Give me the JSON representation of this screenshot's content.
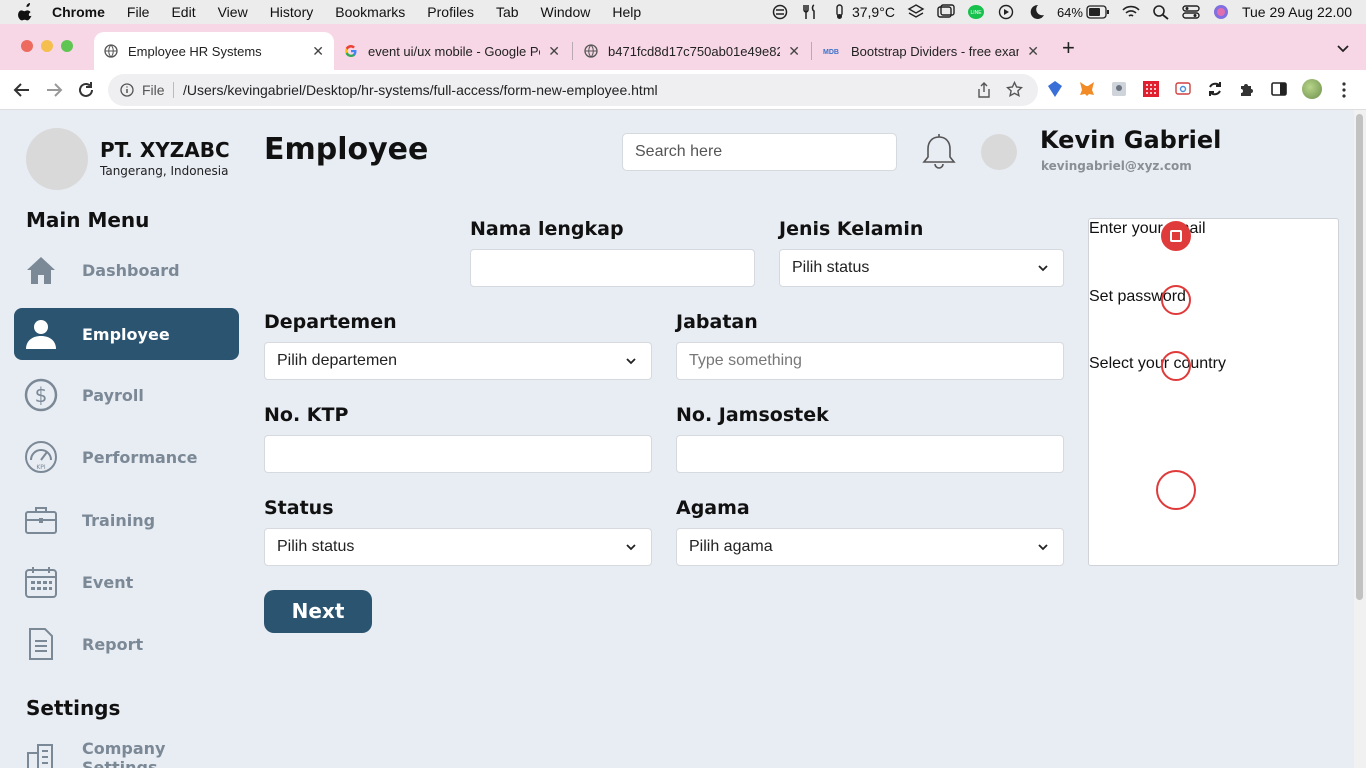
{
  "macos": {
    "app_name": "Chrome",
    "menus": [
      "File",
      "Edit",
      "View",
      "History",
      "Bookmarks",
      "Profiles",
      "Tab",
      "Window",
      "Help"
    ],
    "temperature": "37,9°C",
    "battery": "64%",
    "datetime": "Tue 29 Aug  22.00"
  },
  "browser": {
    "tabs": [
      {
        "label": "Employee HR Systems",
        "icon": "globe-icon"
      },
      {
        "label": "event ui/ux mobile - Google Pe",
        "icon": "google-icon"
      },
      {
        "label": "b471fcd8d17c750ab01e49e82",
        "icon": "globe-icon"
      },
      {
        "label": "Bootstrap Dividers - free exam",
        "icon": "mdb-icon"
      }
    ],
    "scheme_label": "File",
    "url": "/Users/kevingabriel/Desktop/hr-systems/full-access/form-new-employee.html"
  },
  "sidebar": {
    "company_name": "PT. XYZABC",
    "company_location": "Tangerang, Indonesia",
    "main_menu_title": "Main Menu",
    "items": [
      {
        "label": "Dashboard",
        "icon": "home-icon"
      },
      {
        "label": "Employee",
        "icon": "user-icon"
      },
      {
        "label": "Payroll",
        "icon": "dollar-icon"
      },
      {
        "label": "Performance",
        "icon": "gauge-icon"
      },
      {
        "label": "Training",
        "icon": "briefcase-icon"
      },
      {
        "label": "Event",
        "icon": "calendar-icon"
      },
      {
        "label": "Report",
        "icon": "document-icon"
      }
    ],
    "settings_title": "Settings",
    "settings_items": [
      {
        "label": "Company Settings",
        "icon": "building-icon"
      }
    ]
  },
  "header": {
    "page_title": "Employee",
    "search_placeholder": "Search here",
    "user_name": "Kevin Gabriel",
    "user_email": "kevingabriel@xyz.com"
  },
  "form": {
    "nama_label": "Nama lengkap",
    "nama_value": "",
    "gender_label": "Jenis Kelamin",
    "gender_value": "Pilih status",
    "dept_label": "Departemen",
    "dept_value": "Pilih departemen",
    "jabatan_label": "Jabatan",
    "jabatan_placeholder": "Type something",
    "ktp_label": "No. KTP",
    "ktp_value": "",
    "jamsostek_label": "No. Jamsostek",
    "jamsostek_value": "",
    "status_label": "Status",
    "status_value": "Pilih status",
    "agama_label": "Agama",
    "agama_value": "Pilih agama",
    "next_label": "Next"
  },
  "overlay": {
    "lines": [
      "Enter your email",
      "Set password",
      "Select your country"
    ]
  },
  "colors": {
    "accent": "#2b5470",
    "page_bg": "#e8ecf3",
    "marker_red": "#e03b3b",
    "tab_strip": "#f7d7e5"
  }
}
